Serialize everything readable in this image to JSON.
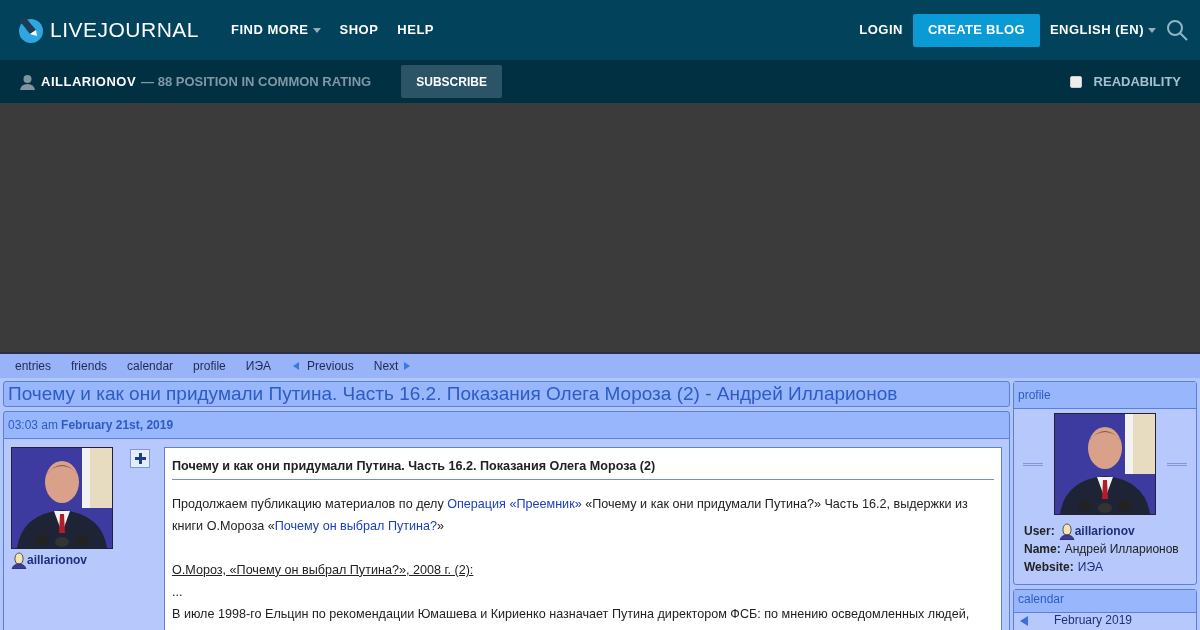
{
  "header": {
    "logo_text": "LIVEJOURNAL",
    "nav": [
      {
        "label": "FIND MORE",
        "dropdown": true
      },
      {
        "label": "SHOP",
        "dropdown": false
      },
      {
        "label": "HELP",
        "dropdown": false
      }
    ],
    "login": "LOGIN",
    "create_blog": "CREATE BLOG",
    "language": "ENGLISH (EN)"
  },
  "subbar": {
    "username": "AILLARIONOV",
    "rating": "— 88 POSITION IN COMMON RATING",
    "subscribe": "SUBSCRIBE",
    "readability": {
      "label": "READABILITY",
      "checked": false
    }
  },
  "journal_nav": [
    {
      "label": "entries",
      "kind": "link"
    },
    {
      "label": "friends",
      "kind": "link"
    },
    {
      "label": "calendar",
      "kind": "link"
    },
    {
      "label": "profile",
      "kind": "link"
    },
    {
      "label": "ИЭА",
      "kind": "link"
    },
    {
      "label": "Previous",
      "kind": "prev"
    },
    {
      "label": "Next",
      "kind": "next"
    }
  ],
  "entry": {
    "title": "Почему и как они придумали Путина. Часть 16.2. Показания Олега Мороза (2) - Андрей Илларионов",
    "time": "03:03 am",
    "date": "February 21st, 2019",
    "user": "aillarionov",
    "heading": "Почему и как они придумали Путина. Часть 16.2. Показания Олега Мороза (2)",
    "paragraphs": [
      {
        "kind": "text",
        "segments": [
          {
            "kind": "text",
            "text": "Продолжаем публикацию материалов по делу "
          },
          {
            "kind": "link",
            "text": "Операция «Преемник»"
          },
          {
            "kind": "text",
            "text": " «Почему и как они придумали Путина?» Часть 16.2, выдержки из книги О.Мороза «"
          },
          {
            "kind": "link",
            "text": "Почему он выбрал Путина?"
          },
          {
            "kind": "text",
            "text": "»"
          }
        ]
      },
      {
        "kind": "underline",
        "segments": [
          {
            "kind": "text",
            "text": "О.Мороз, «Почему он выбрал Путина?», 2008 г. (2):"
          }
        ]
      },
      {
        "kind": "text",
        "segments": [
          {
            "kind": "text",
            "text": "..."
          }
        ]
      },
      {
        "kind": "text",
        "segments": [
          {
            "kind": "text",
            "text": "В июле 1998-го Ельцин по рекомендации Юмашева и Кириенко назначает Путина директором ФСБ: по мнению осведомленных людей,"
          }
        ]
      }
    ]
  },
  "sidebar": {
    "profile": {
      "title": "profile",
      "rows": [
        {
          "label": "User:",
          "value": "aillarionov",
          "kind": "user"
        },
        {
          "label": "Name:",
          "value": "Андрей Илларионов",
          "kind": "text"
        },
        {
          "label": "Website:",
          "value": "ИЭА",
          "kind": "link"
        }
      ]
    },
    "calendar": {
      "title": "calendar",
      "month": "February 2019"
    }
  }
}
